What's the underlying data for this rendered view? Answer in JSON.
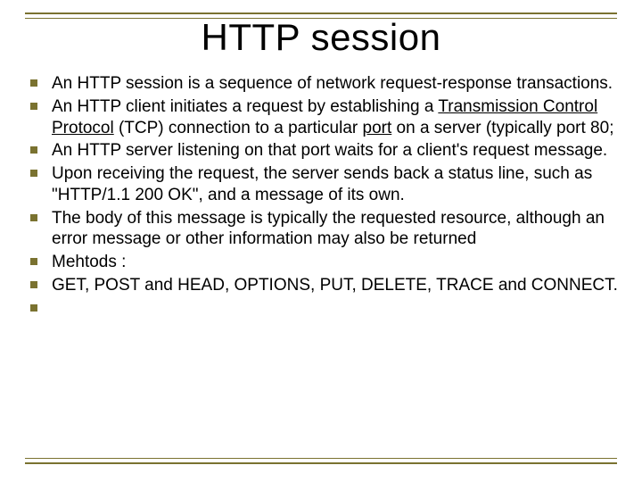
{
  "title": "HTTP session",
  "bullets": [
    {
      "type": "plain",
      "text": "An HTTP session is a sequence of network request-response transactions."
    },
    {
      "type": "rich",
      "parts": [
        {
          "t": " An HTTP client initiates a request by establishing a "
        },
        {
          "t": "Transmission Control Protocol",
          "link": true
        },
        {
          "t": " (TCP) connection to a particular "
        },
        {
          "t": "port",
          "link": true
        },
        {
          "t": " on a server (typically port 80;"
        }
      ]
    },
    {
      "type": "plain",
      "text": "An HTTP server listening on that port waits for a client's request message."
    },
    {
      "type": "plain",
      "text": "Upon receiving the request, the server sends back a status line, such as \"HTTP/1.1 200 OK\", and a message of its own."
    },
    {
      "type": "plain",
      "text": "The body of this message is typically the requested resource, although an error message or other information may also be returned"
    },
    {
      "type": "plain",
      "text": "Mehtods :"
    },
    {
      "type": "plain",
      "text": "GET, POST and HEAD, OPTIONS, PUT, DELETE, TRACE and CONNECT."
    },
    {
      "type": "empty"
    }
  ],
  "colors": {
    "accent": "#7a7230"
  }
}
